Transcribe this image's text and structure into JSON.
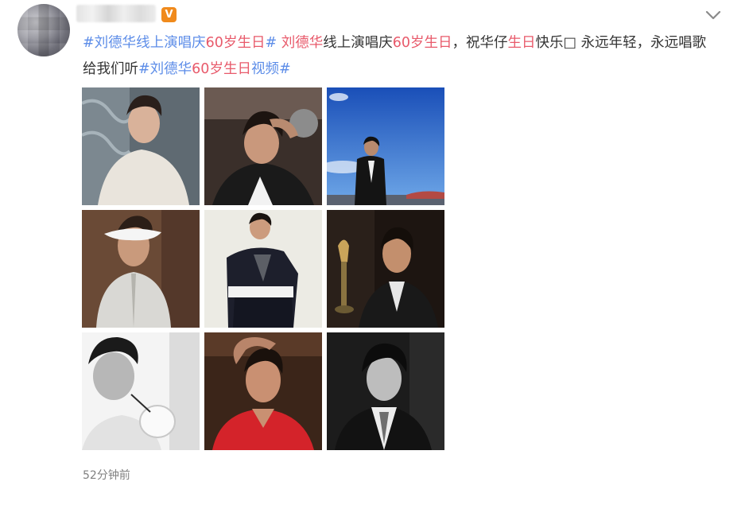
{
  "post": {
    "text_segments": [
      {
        "text": "#",
        "kind": "topic"
      },
      {
        "text": "刘德华",
        "kind": "topic-blue"
      },
      {
        "text": "线上演唱庆",
        "kind": "topic-blue"
      },
      {
        "text": "60",
        "kind": "topic-blue"
      },
      {
        "text": "岁生日",
        "kind": "topic-red"
      },
      {
        "text": "#",
        "kind": "topic"
      },
      {
        "text": " ",
        "kind": "plain"
      },
      {
        "text": "刘德华",
        "kind": "topic-red"
      },
      {
        "text": "线上演唱庆",
        "kind": "plain"
      },
      {
        "text": "60岁生日",
        "kind": "kw"
      },
      {
        "text": "，祝华仔",
        "kind": "plain"
      },
      {
        "text": "生日",
        "kind": "kw"
      },
      {
        "text": "快乐□ 永远年轻，永远唱歌给我们听",
        "kind": "plain"
      },
      {
        "text": "#",
        "kind": "topic"
      },
      {
        "text": "刘德华",
        "kind": "topic-blue"
      },
      {
        "text": "60岁生日",
        "kind": "topic-red"
      },
      {
        "text": "视频",
        "kind": "topic-blue"
      },
      {
        "text": "#",
        "kind": "topic"
      }
    ],
    "vip_badge": "V",
    "timestamp": "52分钟前"
  },
  "icons": {
    "menu": "chevron-down-icon",
    "verified": "vip-badge-icon"
  },
  "colors": {
    "topic_blue": "#5d8de8",
    "topic_red": "#e85a6b",
    "badge_orange": "#f08a1c",
    "timestamp_gray": "#808080"
  },
  "photos": [
    {
      "alt": "photo-1"
    },
    {
      "alt": "photo-2"
    },
    {
      "alt": "photo-3"
    },
    {
      "alt": "photo-4"
    },
    {
      "alt": "photo-5"
    },
    {
      "alt": "photo-6"
    },
    {
      "alt": "photo-7"
    },
    {
      "alt": "photo-8"
    },
    {
      "alt": "photo-9"
    }
  ]
}
